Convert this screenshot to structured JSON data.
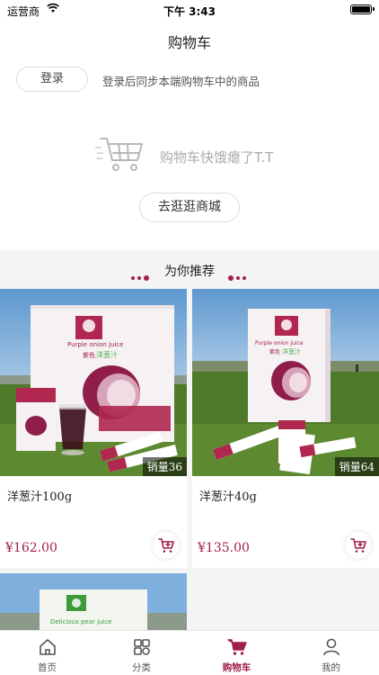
{
  "status": {
    "carrier": "运营商",
    "time": "下午 3:43"
  },
  "nav": {
    "title": "购物车"
  },
  "login": {
    "button": "登录",
    "hint": "登录后同步本端购物车中的商品"
  },
  "empty": {
    "message": "购物车快饿瘪了T.T",
    "shop_button": "去逛逛商城"
  },
  "recommend": {
    "title": "为你推荐"
  },
  "products": [
    {
      "name": "洋葱汁100g",
      "price": "¥162.00",
      "sales": "销量36",
      "box_en": "Purple onion juice",
      "box_cn": "洋葱汁",
      "box_color": "紫色"
    },
    {
      "name": "洋葱汁40g",
      "price": "¥135.00",
      "sales": "销量64",
      "box_en": "Purple onion juice",
      "box_cn": "洋葱汁",
      "box_color": "紫色"
    },
    {
      "box_en": "Delicious pear juice"
    }
  ],
  "tabs": [
    {
      "label": "首页",
      "icon": "home-icon"
    },
    {
      "label": "分类",
      "icon": "category-icon"
    },
    {
      "label": "购物车",
      "icon": "cart-icon",
      "active": true
    },
    {
      "label": "我的",
      "icon": "profile-icon"
    }
  ],
  "colors": {
    "accent": "#a01f4a",
    "background": "#f4f4f4"
  }
}
